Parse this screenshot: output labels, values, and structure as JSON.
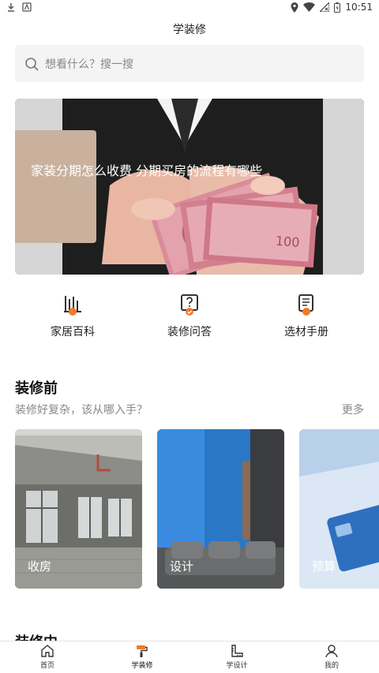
{
  "status": {
    "time": "10:51"
  },
  "header": {
    "title": "学装修"
  },
  "search": {
    "placeholder": "想看什么？搜一搜"
  },
  "banner": {
    "title": "家装分期怎么收费 分期买房的流程有哪些"
  },
  "quick_links": [
    {
      "label": "家居百科",
      "icon": "encyclopedia-icon"
    },
    {
      "label": "装修问答",
      "icon": "question-icon"
    },
    {
      "label": "选材手册",
      "icon": "manual-icon"
    }
  ],
  "section_before": {
    "title": "装修前",
    "subtitle": "装修好复杂，该从哪入手？",
    "more": "更多",
    "cards": [
      {
        "label": "收房"
      },
      {
        "label": "设计"
      },
      {
        "label": "预算"
      }
    ]
  },
  "section_during": {
    "title": "装修中"
  },
  "tabs": [
    {
      "label": "首页",
      "icon": "home-icon"
    },
    {
      "label": "学装修",
      "icon": "paint-roller-icon"
    },
    {
      "label": "学设计",
      "icon": "ruler-icon"
    },
    {
      "label": "我的",
      "icon": "user-icon"
    }
  ],
  "colors": {
    "accent": "#f07a2a",
    "banner_overlay": "#c9b19d"
  }
}
